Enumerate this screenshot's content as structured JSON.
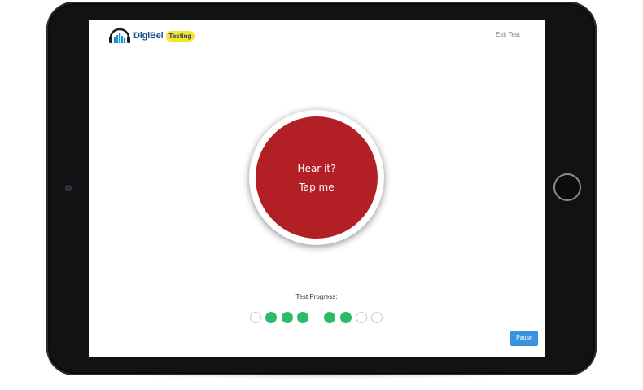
{
  "header": {
    "logo_text": "DigiBel",
    "logo_badge": "Testing",
    "logo_icon": "headphones-equalizer-icon",
    "exit_label": "Exit Test"
  },
  "tap_button": {
    "line1": "Hear it?",
    "line2": "Tap me",
    "color": "#b21f24"
  },
  "progress": {
    "label": "Test Progress:",
    "steps": [
      "pending",
      "done",
      "done",
      "done",
      "done",
      "done",
      "pending",
      "pending"
    ],
    "done_color": "#2dbb6b"
  },
  "pause": {
    "label": "Pause",
    "color": "#3a93e0"
  }
}
